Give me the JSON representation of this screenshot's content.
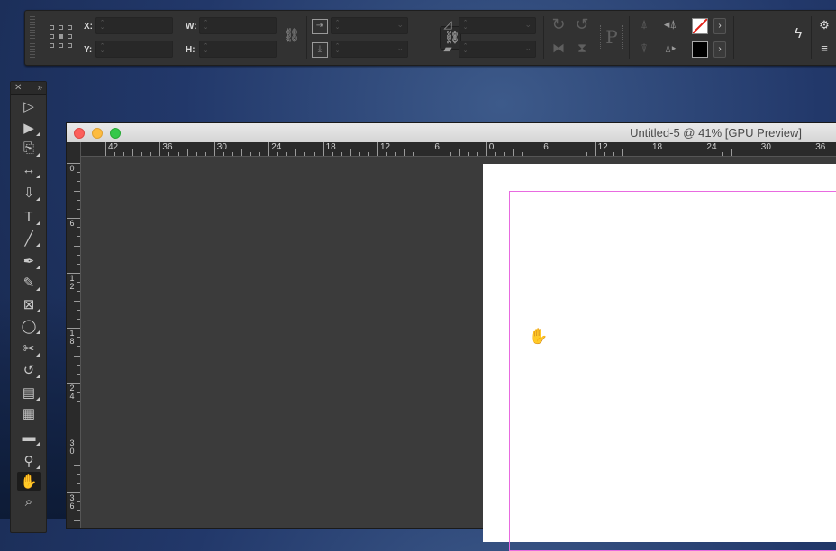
{
  "control_panel": {
    "x_label": "X:",
    "y_label": "Y:",
    "w_label": "W:",
    "h_label": "H:",
    "x_value": "",
    "y_value": "",
    "w_value": "",
    "h_value": "",
    "proxy_glyph": "P"
  },
  "tools_panel": {
    "close_glyph": "✕",
    "collapse_glyph": "»",
    "tools": [
      {
        "name": "selection-tool",
        "glyph": "▷"
      },
      {
        "name": "direct-selection-tool",
        "glyph": "▶"
      },
      {
        "name": "page-tool",
        "glyph": "⎘"
      },
      {
        "name": "gap-tool",
        "glyph": "↔"
      },
      {
        "name": "content-collector-tool",
        "glyph": "⇩"
      },
      {
        "name": "type-tool",
        "glyph": "T"
      },
      {
        "name": "line-tool",
        "glyph": "╱"
      },
      {
        "name": "pen-tool",
        "glyph": "✒"
      },
      {
        "name": "pencil-tool",
        "glyph": "✎"
      },
      {
        "name": "rectangle-frame-tool",
        "glyph": "⊠"
      },
      {
        "name": "ellipse-tool",
        "glyph": "◯"
      },
      {
        "name": "scissors-tool",
        "glyph": "✂"
      },
      {
        "name": "free-transform-tool",
        "glyph": "↺"
      },
      {
        "name": "gradient-swatch-tool",
        "glyph": "▤"
      },
      {
        "name": "gradient-feather-tool",
        "glyph": "▦"
      },
      {
        "name": "note-tool",
        "glyph": "▬"
      },
      {
        "name": "eyedropper-tool",
        "glyph": "⚲"
      },
      {
        "name": "hand-tool",
        "glyph": "✋"
      },
      {
        "name": "zoom-tool",
        "glyph": "⌕"
      }
    ]
  },
  "document": {
    "title": "Untitled-5 @ 41% [GPU Preview]",
    "horizontal_ruler": [
      "42",
      "36",
      "30",
      "24",
      "18",
      "12",
      "6",
      "0",
      "6",
      "12",
      "18",
      "24",
      "30",
      "36"
    ],
    "vertical_ruler": [
      "0",
      "6",
      "12",
      "18",
      "24",
      "30",
      "36"
    ]
  },
  "colors": {
    "margin_guide": "#e86ae0",
    "pasteboard": "#3b3b3b",
    "close_light": "#fc605c",
    "minimize_light": "#fdbc40",
    "zoom_light": "#34c84a"
  }
}
